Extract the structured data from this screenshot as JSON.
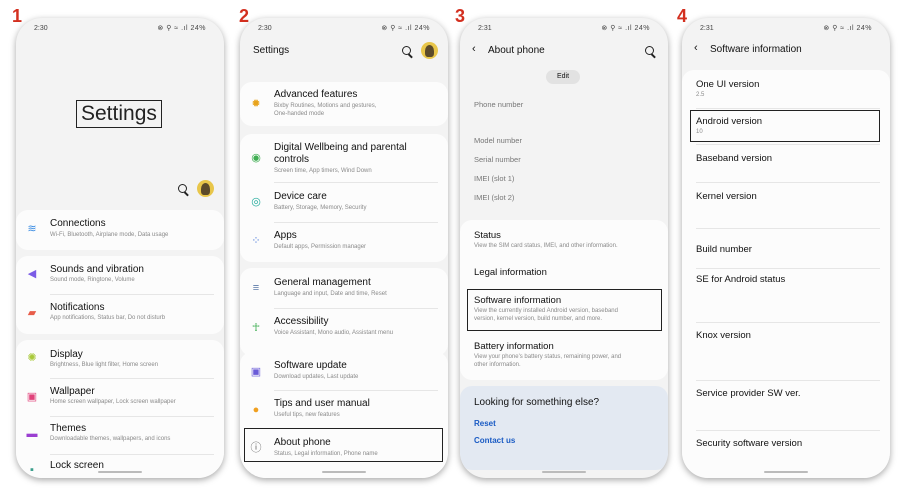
{
  "steps": [
    "1",
    "2",
    "3",
    "4"
  ],
  "status": {
    "p1_time": "2:30",
    "p2_time": "2:30",
    "p3_time": "2:31",
    "p4_time": "2:31",
    "right": "24%"
  },
  "phone1": {
    "big_title": "Settings",
    "items": [
      {
        "title": "Connections",
        "sub": "Wi-Fi, Bluetooth, Airplane mode, Data usage",
        "icon": "wifi-icon"
      },
      {
        "title": "Sounds and vibration",
        "sub": "Sound mode, Ringtone, Volume",
        "icon": "volume-icon"
      },
      {
        "title": "Notifications",
        "sub": "App notifications, Status bar, Do not disturb",
        "icon": "bell-icon"
      },
      {
        "title": "Display",
        "sub": "Brightness, Blue light filter, Home screen",
        "icon": "sun-icon"
      },
      {
        "title": "Wallpaper",
        "sub": "Home screen wallpaper, Lock screen wallpaper",
        "icon": "image-icon"
      },
      {
        "title": "Themes",
        "sub": "Downloadable themes, wallpapers, and icons",
        "icon": "brush-icon"
      },
      {
        "title": "Lock screen",
        "sub": "",
        "icon": "lock-icon"
      }
    ]
  },
  "phone2": {
    "title": "Settings",
    "items": [
      {
        "title": "Advanced features",
        "sub1": "Bixby Routines, Motions and gestures,",
        "sub2": "One-handed mode",
        "icon": "gear-plus-icon"
      },
      {
        "title": "Digital Wellbeing and parental",
        "title2": "controls",
        "sub1": "Screen time, App timers, Wind Down",
        "icon": "wellbeing-icon"
      },
      {
        "title": "Device care",
        "sub1": "Battery, Storage, Memory, Security",
        "icon": "device-care-icon"
      },
      {
        "title": "Apps",
        "sub1": "Default apps, Permission manager",
        "icon": "apps-icon"
      },
      {
        "title": "General management",
        "sub1": "Language and input, Date and time, Reset",
        "icon": "sliders-icon"
      },
      {
        "title": "Accessibility",
        "sub1": "Voice Assistant, Mono audio, Assistant menu",
        "icon": "accessibility-icon"
      },
      {
        "title": "Software update",
        "sub1": "Download updates, Last update",
        "icon": "update-icon"
      },
      {
        "title": "Tips and user manual",
        "sub1": "Useful tips, new features",
        "icon": "bulb-icon"
      },
      {
        "title": "About phone",
        "sub1": "Status, Legal information, Phone name",
        "icon": "info-icon"
      }
    ]
  },
  "phone3": {
    "title": "About phone",
    "edit": "Edit",
    "fields": [
      "Phone number",
      "Model number",
      "Serial number",
      "IMEI (slot 1)",
      "IMEI (slot 2)"
    ],
    "status": {
      "title": "Status",
      "sub": "View the SIM card status, IMEI, and other information."
    },
    "legal": "Legal information",
    "software": {
      "title": "Software information",
      "sub1": "View the currently installed Android version, baseband",
      "sub2": "version, kernel version, build number, and more."
    },
    "battery": {
      "title": "Battery information",
      "sub1": "View your phone's battery status, remaining power, and",
      "sub2": "other information."
    },
    "looking": "Looking for something else?",
    "reset": "Reset",
    "contact": "Contact us"
  },
  "phone4": {
    "title": "Software information",
    "rows": [
      {
        "title": "One UI version",
        "sub": "2.5"
      },
      {
        "title": "Android version",
        "sub": "10"
      },
      {
        "title": "Baseband version",
        "sub": ""
      },
      {
        "title": "Kernel version",
        "sub": ""
      },
      {
        "title": "Build number",
        "sub": ""
      },
      {
        "title": "SE for Android status",
        "sub": ""
      },
      {
        "title": "Knox version",
        "sub": ""
      },
      {
        "title": "Service provider SW ver.",
        "sub": ""
      },
      {
        "title": "Security software version",
        "sub": ""
      }
    ]
  },
  "colors": {
    "accent_blue": "#1a5bc4",
    "step_red": "#d32f1f"
  }
}
